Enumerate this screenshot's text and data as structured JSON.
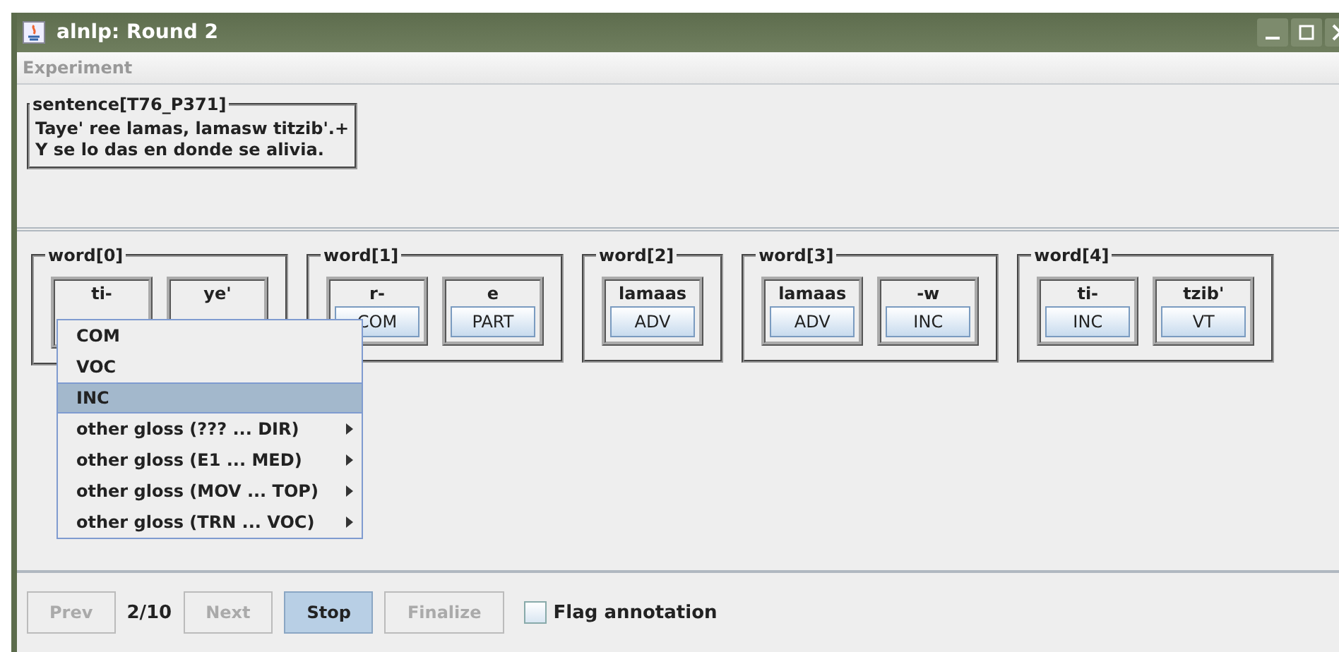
{
  "window": {
    "title": "alnlp: Round 2"
  },
  "menu_bar": [
    {
      "label": "Experiment",
      "disabled": true
    }
  ],
  "sentence": {
    "title": "sentence[T76_P371]",
    "lines": [
      "Taye' ree lamas, lamasw titzib'.+",
      "Y se lo das en donde se alivia."
    ]
  },
  "words": [
    {
      "title": "word[0]",
      "morphemes": [
        {
          "form": "ti-"
        },
        {
          "form": "ye'"
        }
      ]
    },
    {
      "title": "word[1]",
      "morphemes": [
        {
          "form": "r-",
          "gloss": "COM"
        },
        {
          "form": "e",
          "gloss": "PART"
        }
      ]
    },
    {
      "title": "word[2]",
      "morphemes": [
        {
          "form": "lamaas",
          "gloss": "ADV"
        }
      ]
    },
    {
      "title": "word[3]",
      "morphemes": [
        {
          "form": "lamaas",
          "gloss": "ADV"
        },
        {
          "form": "-w",
          "gloss": "INC"
        }
      ]
    },
    {
      "title": "word[4]",
      "morphemes": [
        {
          "form": "ti-",
          "gloss": "INC"
        },
        {
          "form": "tzib'",
          "gloss": "VT"
        }
      ]
    }
  ],
  "popup_menu": [
    {
      "label": "COM",
      "kind": "item",
      "selected": false
    },
    {
      "label": "VOC",
      "kind": "item",
      "selected": false
    },
    {
      "label": "INC",
      "kind": "item",
      "selected": true
    },
    {
      "label": "other gloss (??? ... DIR)",
      "kind": "submenu",
      "selected": false
    },
    {
      "label": "other gloss (E1 ... MED)",
      "kind": "submenu",
      "selected": false
    },
    {
      "label": "other gloss (MOV ... TOP)",
      "kind": "submenu",
      "selected": false
    },
    {
      "label": "other gloss (TRN ... VOC)",
      "kind": "submenu",
      "selected": false
    }
  ],
  "bottom_bar": {
    "items": [
      {
        "kind": "button",
        "label": "Prev",
        "disabled": true,
        "focused": false
      },
      {
        "kind": "counter",
        "label": "2/10"
      },
      {
        "kind": "button",
        "label": "Next",
        "disabled": true,
        "focused": false
      },
      {
        "kind": "button",
        "label": "Stop",
        "disabled": false,
        "focused": true
      },
      {
        "kind": "button",
        "label": "Finalize",
        "disabled": true,
        "focused": false
      },
      {
        "kind": "checkbox",
        "label": "Flag annotation",
        "checked": false
      }
    ]
  }
}
